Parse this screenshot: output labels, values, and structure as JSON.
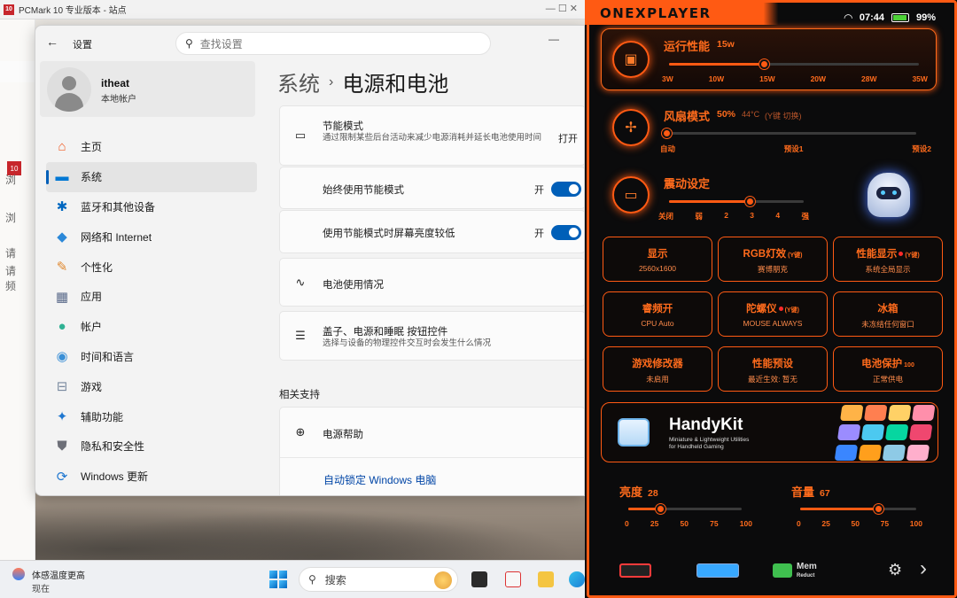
{
  "pcmark": {
    "title": "PCMark 10 专业版本 - 站点",
    "logo": "10"
  },
  "bgwin": {
    "labels": [
      "浏",
      "浏",
      "请",
      "请",
      "频"
    ]
  },
  "settings": {
    "app_title": "设置",
    "search_placeholder": "查找设置",
    "user": {
      "name": "itheat",
      "type": "本地帐户"
    },
    "nav": [
      {
        "label": "主页",
        "icon": "home-icon",
        "glyph": "⌂",
        "color": "#f05a22"
      },
      {
        "label": "系统",
        "icon": "monitor-icon",
        "glyph": "▬",
        "color": "#0078d4",
        "selected": true
      },
      {
        "label": "蓝牙和其他设备",
        "icon": "bluetooth-icon",
        "glyph": "✱",
        "color": "#0067c0"
      },
      {
        "label": "网络和 Internet",
        "icon": "wifi-icon",
        "glyph": "◆",
        "color": "#2b88d8"
      },
      {
        "label": "个性化",
        "icon": "brush-icon",
        "glyph": "✎",
        "color": "#e0882f"
      },
      {
        "label": "应用",
        "icon": "apps-icon",
        "glyph": "▦",
        "color": "#5a6a8a"
      },
      {
        "label": "帐户",
        "icon": "person-icon",
        "glyph": "●",
        "color": "#2fb193"
      },
      {
        "label": "时间和语言",
        "icon": "globe-clock-icon",
        "glyph": "◉",
        "color": "#3a8fd6"
      },
      {
        "label": "游戏",
        "icon": "gamepad-icon",
        "glyph": "⊟",
        "color": "#7a8aa0"
      },
      {
        "label": "辅助功能",
        "icon": "accessibility-icon",
        "glyph": "✦",
        "color": "#1f77d0"
      },
      {
        "label": "隐私和安全性",
        "icon": "shield-icon",
        "glyph": "⛊",
        "color": "#6d6f78"
      },
      {
        "label": "Windows 更新",
        "icon": "update-icon",
        "glyph": "⟳",
        "color": "#1f77d0"
      }
    ],
    "breadcrumb": {
      "parent": "系统",
      "sep": "›",
      "current": "电源和电池"
    },
    "cards": {
      "saver": {
        "title": "节能模式",
        "desc": "通过限制某些后台活动来减少电源消耗并延长电池使用时间",
        "action": "打开"
      },
      "always": {
        "title": "始终使用节能模式",
        "state": "开"
      },
      "dim": {
        "title": "使用节能模式时屏幕亮度较低",
        "state": "开"
      },
      "usage": {
        "title": "电池使用情况"
      },
      "lid": {
        "title": "盖子、电源和睡眠 按钮控件",
        "desc": "选择与设备的物理控件交互时会发生什么情况"
      },
      "related_header": "相关支持",
      "help": {
        "title": "电源帮助"
      },
      "link1": "自动锁定 Windows 电脑"
    }
  },
  "taskbar": {
    "weather_line1": "体感温度更高",
    "weather_line2": "现在",
    "search": "搜索"
  },
  "oxp": {
    "brand": "ONEXPLAYER",
    "time": "07:44",
    "battery": "99%",
    "perf": {
      "title": "运行性能",
      "value": "15w",
      "ticks": [
        "3W",
        "10W",
        "15W",
        "20W",
        "28W",
        "35W"
      ],
      "level": 0.38
    },
    "fan": {
      "title": "风扇模式",
      "value": "50%",
      "temp": "44°C",
      "note": "(Y键 切换)",
      "ticks": [
        "自动",
        "预设1",
        "预设2"
      ],
      "level": 0.0
    },
    "vib": {
      "title": "震动设定",
      "ticks": [
        "关闭",
        "弱",
        "2",
        "3",
        "4",
        "强"
      ],
      "level": 0.6
    },
    "tiles": [
      {
        "title": "显示",
        "value": "2560x1600"
      },
      {
        "title": "RGB灯效",
        "tag": "(Y键)",
        "value": "赛博朋克"
      },
      {
        "title": "性能显示",
        "tag": "(Y键)",
        "value": "系统全局显示",
        "dot": true
      },
      {
        "title": "睿频开",
        "value": "CPU Auto"
      },
      {
        "title": "陀螺仪",
        "tag": "(Y键)",
        "value": "MOUSE ALWAYS",
        "dot": true
      },
      {
        "title": "冰箱",
        "value": "未冻结任何窗口"
      },
      {
        "title": "游戏修改器",
        "value": "未启用"
      },
      {
        "title": "性能预设",
        "value": "最近生效: 暂无"
      },
      {
        "title": "电池保护",
        "tag": "100",
        "value": "正常供电"
      }
    ],
    "handy": {
      "title": "HandyKit",
      "sub1": "Miniature & Lightweight Utilities",
      "sub2": "for Handheld Gaming"
    },
    "brightness": {
      "label": "亮度",
      "value": "28",
      "ticks": [
        "0",
        "25",
        "50",
        "75",
        "100"
      ],
      "level": 0.28
    },
    "volume": {
      "label": "音量",
      "value": "67",
      "ticks": [
        "0",
        "25",
        "50",
        "75",
        "100"
      ],
      "level": 0.67
    },
    "mem": {
      "line1": "Mem",
      "line2": "Reduct"
    },
    "colors": {
      "accent": "#ff5a13",
      "battery": "#4cd137"
    }
  }
}
